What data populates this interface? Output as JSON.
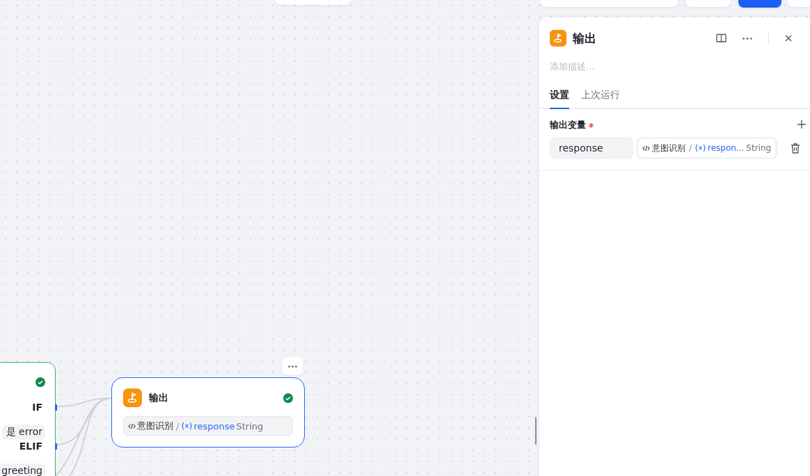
{
  "canvas": {
    "branch_node": {
      "status_ok": true,
      "branches": [
        {
          "label": "IF",
          "condition": "是 error"
        },
        {
          "label": "ELIF",
          "condition": "greeting"
        }
      ]
    },
    "output_node": {
      "title": "输出",
      "status_ok": true,
      "selected": true,
      "chip": {
        "source_node": "意图识别",
        "separator": "/",
        "variable": "response",
        "type": "String"
      }
    }
  },
  "panel": {
    "title": "输出",
    "description_placeholder": "添加描述...",
    "tabs": [
      {
        "label": "设置",
        "selected": true
      },
      {
        "label": "上次运行",
        "selected": false
      }
    ],
    "section": {
      "label": "输出变量",
      "required": true
    },
    "variables": [
      {
        "name": "response",
        "source_node": "意图识别",
        "separator": "/",
        "variable": "respon...",
        "type": "String"
      }
    ]
  }
}
